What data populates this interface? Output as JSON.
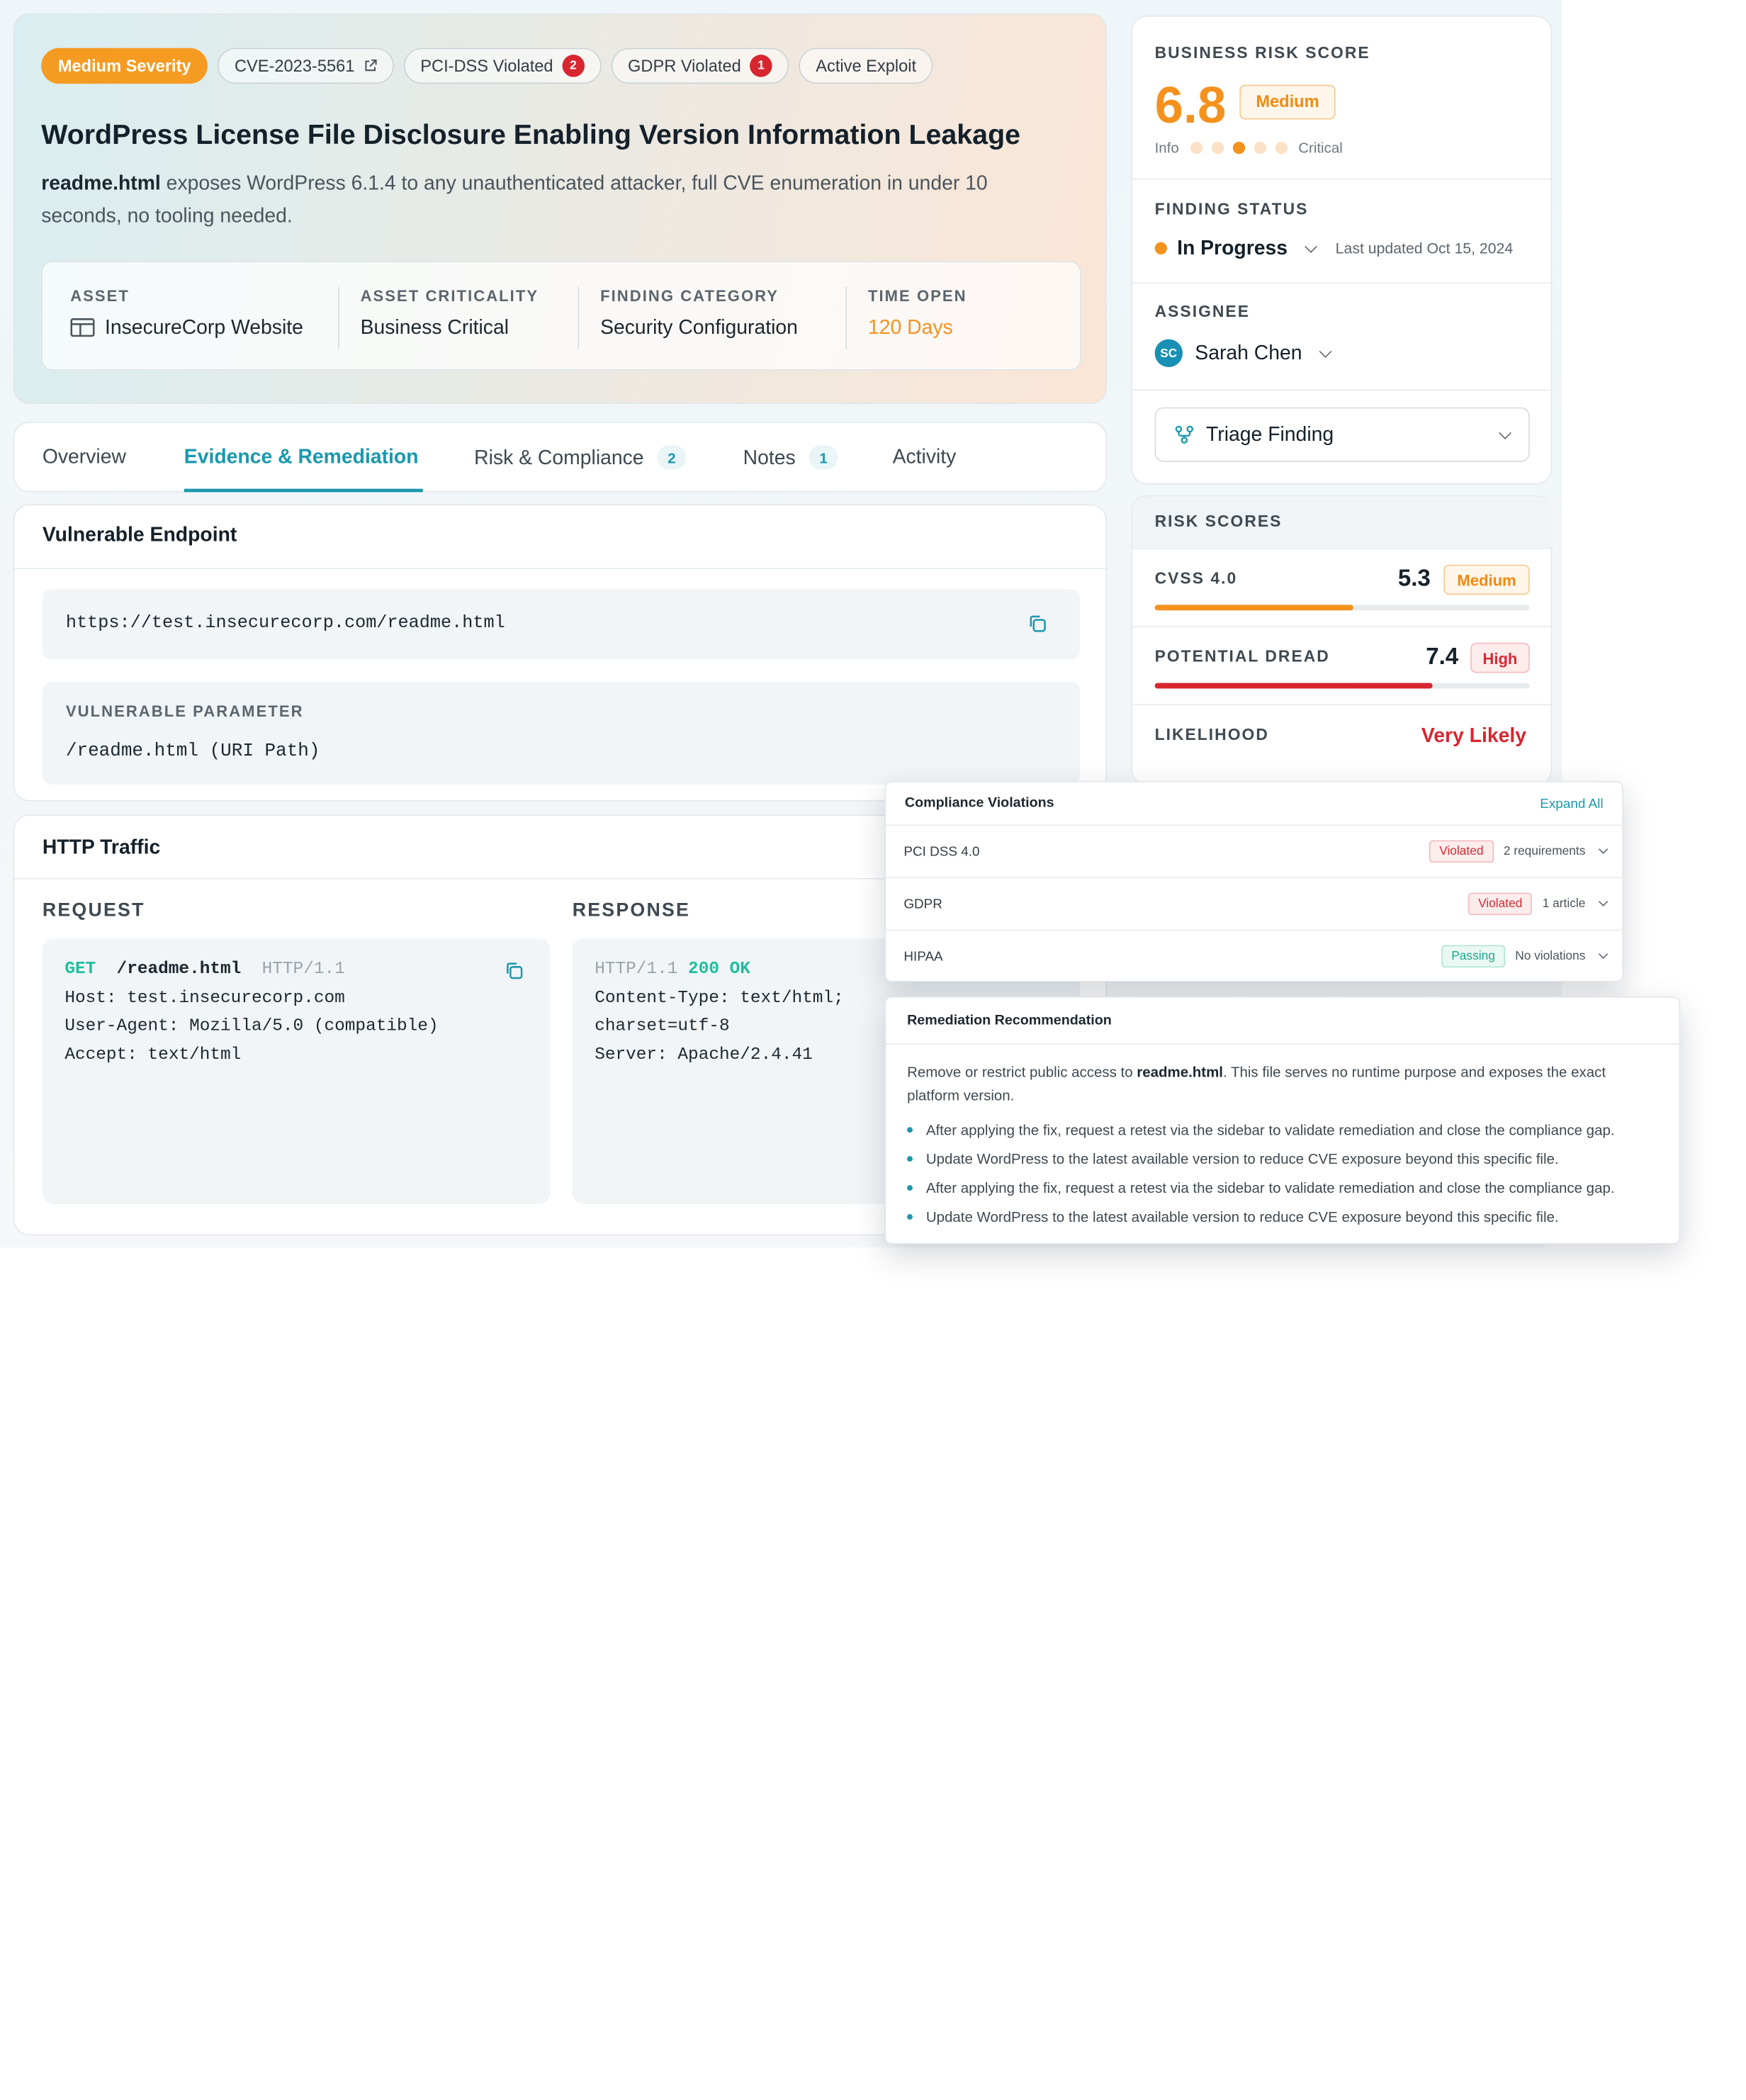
{
  "hero": {
    "severity": "Medium Severity",
    "cve": "CVE-2023-5561",
    "pci": {
      "label": "PCI-DSS Violated",
      "count": "2"
    },
    "gdpr": {
      "label": "GDPR Violated",
      "count": "1"
    },
    "exploit": "Active Exploit",
    "title": "WordPress License File Disclosure Enabling Version Information Leakage",
    "desc_file": "readme.html",
    "desc_rest": " exposes WordPress 6.1.4 to any unauthenticated attacker,  full CVE enumeration in under 10 seconds, no tooling needed.",
    "meta": {
      "asset_label": "ASSET",
      "asset_value": "InsecureCorp Website",
      "criticality_label": "ASSET CRITICALITY",
      "criticality_value": "Business Critical",
      "category_label": "FINDING CATEGORY",
      "category_value": "Security Configuration",
      "time_label": "TIME OPEN",
      "time_value": "120 Days"
    }
  },
  "tabs": {
    "overview": "Overview",
    "evidence": "Evidence & Remediation",
    "risk": "Risk & Compliance",
    "risk_count": "2",
    "notes": "Notes",
    "notes_count": "1",
    "activity": "Activity"
  },
  "endpoint": {
    "title": "Vulnerable Endpoint",
    "url": "https://test.insecurecorp.com/readme.html",
    "param_label": "VULNERABLE PARAMETER",
    "param_value": "/readme.html (URI Path)"
  },
  "http": {
    "title": "HTTP Traffic",
    "request_label": "REQUEST",
    "response_label": "RESPONSE",
    "req": {
      "method": "GET",
      "path": "/readme.html",
      "proto": "HTTP/1.1",
      "host_k": "Host:",
      "host_v": "test.insecurecorp.com",
      "ua_k": "User-Agent:",
      "ua_v": "Mozilla/5.0 (compatible)",
      "accept_k": "Accept:",
      "accept_v": "text/html"
    },
    "res": {
      "proto": "HTTP/1.1",
      "status": "200 OK",
      "ct_k": "Content-Type:",
      "ct_v": "text/html;",
      "charset": "charset=utf-8",
      "server_k": "Server:",
      "server_v": "Apache/2.4.41"
    }
  },
  "sidebar": {
    "risk_label": "BUSINESS RISK SCORE",
    "risk_score": "6.8",
    "risk_badge": "Medium",
    "scale_min": "Info",
    "scale_max": "Critical",
    "scale_level": 3,
    "scale_steps": 5,
    "status_label": "FINDING STATUS",
    "status_value": "In Progress",
    "status_updated": "Last updated Oct 15, 2024",
    "assignee_label": "ASSIGNEE",
    "assignee_initials": "SC",
    "assignee_name": "Sarah Chen",
    "triage": "Triage Finding"
  },
  "risk_scores": {
    "title": "RISK SCORES",
    "cvss_label": "CVSS 4.0",
    "cvss_value": "5.3",
    "cvss_badge": "Medium",
    "cvss_fill": 0.53,
    "dread_label": "POTENTIAL DREAD",
    "dread_value": "7.4",
    "dread_badge": "High",
    "dread_fill": 0.74,
    "likelihood_label": "LIKELIHOOD",
    "likelihood_value": "Very Likely"
  },
  "compliance": {
    "title": "Compliance Violations",
    "expand": "Expand All",
    "rows": [
      {
        "name": "PCI DSS 4.0",
        "status": "Violated",
        "detail": "2 requirements"
      },
      {
        "name": "GDPR",
        "status": "Violated",
        "detail": "1 article"
      },
      {
        "name": "HIPAA",
        "status": "Passing",
        "detail": "No violations"
      }
    ]
  },
  "remediation": {
    "title": "Remediation Recommendation",
    "text_before": "Remove or restrict public access to ",
    "text_file": "readme.html",
    "text_after": ". This file serves no runtime purpose and exposes the exact platform version.",
    "bullets": [
      "After applying the fix, request a retest via the sidebar to validate remediation and close the compliance gap.",
      "Update WordPress to the latest available version to reduce CVE exposure beyond this specific file.",
      "After applying the fix, request a retest via the sidebar to validate remediation and close the compliance gap.",
      "Update WordPress to the latest available version to reduce CVE exposure beyond this specific file."
    ]
  },
  "colors": {
    "accent": "#1a98ac",
    "warning": "#f5921e",
    "danger": "#d8262f",
    "success": "#1aa98c"
  }
}
